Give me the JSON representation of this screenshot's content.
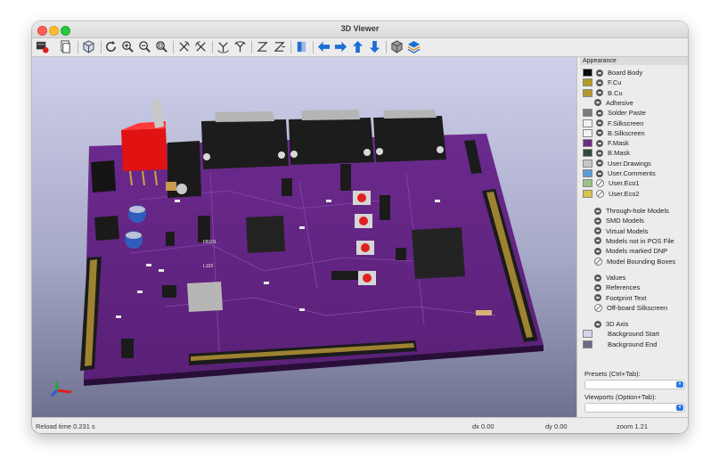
{
  "window": {
    "title": "3D Viewer"
  },
  "toolbar": {
    "buttons": [
      "board-layers-icon",
      "copy-icon",
      "3d-box-icon",
      "reload-icon",
      "zoom-in-icon",
      "zoom-out-icon",
      "zoom-fit-icon",
      "rotate-x-cw-icon",
      "rotate-x-ccw-icon",
      "rotate-y-cw-icon",
      "rotate-y-ccw-icon",
      "rotate-z-cw-icon",
      "rotate-z-ccw-icon",
      "flip-board-icon",
      "pan-left-icon",
      "pan-right-icon",
      "pan-up-icon",
      "pan-down-icon",
      "ortho-box-icon",
      "layer-stack-icon"
    ]
  },
  "appearance": {
    "header": "Appearance",
    "layers": [
      {
        "label": "Board Body",
        "color": "#0a0a0a"
      },
      {
        "label": "F.Cu",
        "color": "#b39a28"
      },
      {
        "label": "B.Cu",
        "color": "#b39a28"
      },
      {
        "label": "Adhesive",
        "color": ""
      },
      {
        "label": "Solder Paste",
        "color": "#7a7a7a"
      },
      {
        "label": "F.Silkscreen",
        "color": "#f2f2f2"
      },
      {
        "label": "B.Silkscreen",
        "color": "#f2f2f2"
      },
      {
        "label": "F.Mask",
        "color": "#6b2c86"
      },
      {
        "label": "B.Mask",
        "color": "#2f4a3a"
      },
      {
        "label": "User.Drawings",
        "color": "#c8c8c8"
      },
      {
        "label": "User.Comments",
        "color": "#5b9bd5"
      },
      {
        "label": "User.Eco1",
        "color": "#9bc08a"
      },
      {
        "label": "User.Eco2",
        "color": "#d9c247"
      }
    ],
    "models": [
      "Through-hole Models",
      "SMD Models",
      "Virtual Models",
      "Models not in POS File",
      "Models marked DNP",
      "Model Bounding Boxes"
    ],
    "text_items": [
      "Values",
      "References",
      "Footprint Text",
      "Off-board Silkscreen"
    ],
    "other_items": [
      {
        "label": "3D Axis",
        "color": ""
      },
      {
        "label": "Background Start",
        "color": "#d4d4ec"
      },
      {
        "label": "Background End",
        "color": "#6a6d86"
      }
    ],
    "presets_label": "Presets (Ctrl+Tab):",
    "viewports_label": "Viewports (Option+Tab):"
  },
  "status": {
    "reload": "Reload time 0.231 s",
    "dx": "dx 0.00",
    "dy": "dy 0.00",
    "zoom": "zoom 1.21"
  },
  "pcb_labels": [
    "FB101",
    "L102"
  ]
}
